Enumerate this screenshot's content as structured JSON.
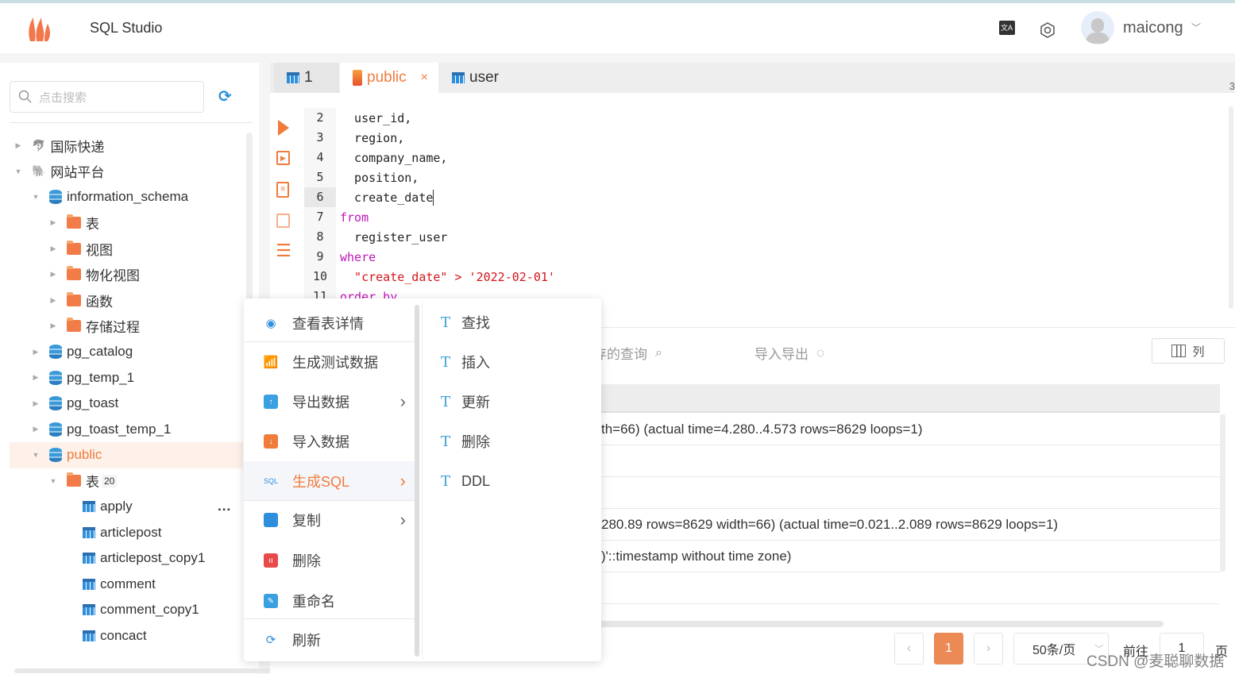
{
  "header": {
    "app_title": "SQL Studio",
    "username": "maicong",
    "icons": [
      "logo-flame",
      "translate-icon",
      "settings-icon",
      "avatar",
      "chevron-down-icon"
    ]
  },
  "sidebar": {
    "search_placeholder": "点击搜索",
    "tree": [
      {
        "label": "国际快递",
        "icon": "mysql-icon",
        "level": 0,
        "expanded": false
      },
      {
        "label": "网站平台",
        "icon": "postgresql-icon",
        "level": 0,
        "expanded": true
      },
      {
        "label": "information_schema",
        "icon": "database-icon",
        "level": 1,
        "expanded": true
      },
      {
        "label": "表",
        "icon": "folder-table-icon",
        "level": 2,
        "expanded": false
      },
      {
        "label": "视图",
        "icon": "folder-view-icon",
        "level": 2,
        "expanded": false
      },
      {
        "label": "物化视图",
        "icon": "folder-mview-icon",
        "level": 2,
        "expanded": false
      },
      {
        "label": "函数",
        "icon": "folder-function-icon",
        "level": 2,
        "expanded": false
      },
      {
        "label": "存储过程",
        "icon": "folder-procedure-icon",
        "level": 2,
        "expanded": false
      },
      {
        "label": "pg_catalog",
        "icon": "database-icon",
        "level": 1,
        "expanded": false
      },
      {
        "label": "pg_temp_1",
        "icon": "database-icon",
        "level": 1,
        "expanded": false
      },
      {
        "label": "pg_toast",
        "icon": "database-icon",
        "level": 1,
        "expanded": false
      },
      {
        "label": "pg_toast_temp_1",
        "icon": "database-icon",
        "level": 1,
        "expanded": false
      },
      {
        "label": "public",
        "icon": "database-icon",
        "level": 1,
        "expanded": true,
        "selected": true
      },
      {
        "label": "表",
        "badge": "20",
        "icon": "folder-table-icon",
        "level": 2,
        "expanded": true
      },
      {
        "label": "apply",
        "icon": "table-icon",
        "level": 3,
        "more": "..."
      },
      {
        "label": "articlepost",
        "icon": "table-icon",
        "level": 3
      },
      {
        "label": "articlepost_copy1",
        "icon": "table-icon",
        "level": 3
      },
      {
        "label": "comment",
        "icon": "table-icon",
        "level": 3
      },
      {
        "label": "comment_copy1",
        "icon": "table-icon",
        "level": 3
      },
      {
        "label": "concact",
        "icon": "table-icon",
        "level": 3
      }
    ]
  },
  "editor": {
    "tabs": [
      {
        "label": "1",
        "icon": "table-icon"
      },
      {
        "label": "public",
        "icon": "scroll-icon",
        "active": true,
        "close": "×"
      },
      {
        "label": "user",
        "icon": "table-icon"
      }
    ],
    "corner_number": "3",
    "lines": [
      {
        "n": "2",
        "parts": [
          {
            "t": "  user_id,",
            "c": "txt"
          }
        ]
      },
      {
        "n": "3",
        "parts": [
          {
            "t": "  region,",
            "c": "txt"
          }
        ]
      },
      {
        "n": "4",
        "parts": [
          {
            "t": "  company_name,",
            "c": "txt"
          }
        ]
      },
      {
        "n": "5",
        "parts": [
          {
            "t": "  position,",
            "c": "txt"
          }
        ]
      },
      {
        "n": "6",
        "parts": [
          {
            "t": "  create_date",
            "c": "txt"
          }
        ],
        "current": true
      },
      {
        "n": "7",
        "parts": [
          {
            "t": "from",
            "c": "kw"
          }
        ]
      },
      {
        "n": "8",
        "parts": [
          {
            "t": "  register_user",
            "c": "txt"
          }
        ]
      },
      {
        "n": "9",
        "parts": [
          {
            "t": "where",
            "c": "kw"
          }
        ]
      },
      {
        "n": "10",
        "parts": [
          {
            "t": "  \"create_date\" > '2022-02-01'",
            "c": "str"
          }
        ]
      },
      {
        "n": "11",
        "parts": [
          {
            "t": "order by",
            "c": "kw"
          }
        ]
      }
    ],
    "colors": {
      "keyword": "#c015b8",
      "string": "#d4141a",
      "accent": "#f07c3c"
    }
  },
  "results": {
    "saved_query_label": "保存的查询",
    "import_export_label": "导入导出",
    "columns_button": "列",
    "rows": [
      "th=66) (actual time=4.280..4.573 rows=8629 loops=1)",
      "",
      "",
      "280.89 rows=8629 width=66) (actual time=0.021..2.089 rows=8629 loops=1)",
      ")'::timestamp without time zone)",
      ""
    ],
    "pagination": {
      "prev": "‹",
      "current": "1",
      "next": "›",
      "page_size": "50条/页",
      "goto_label": "前往",
      "goto_value": "1",
      "page_suffix": "页"
    }
  },
  "context_menu": {
    "items": [
      {
        "label": "查看表详情",
        "icon": "eye-icon"
      },
      {
        "label": "生成测试数据",
        "icon": "chart-icon"
      },
      {
        "label": "导出数据",
        "icon": "export-icon",
        "submenu": true
      },
      {
        "label": "导入数据",
        "icon": "import-icon"
      },
      {
        "label": "生成SQL",
        "icon": "sql-icon",
        "submenu": true,
        "active": true
      },
      {
        "label": "复制",
        "icon": "copy-icon",
        "submenu": true
      },
      {
        "label": "删除",
        "icon": "trash-icon"
      },
      {
        "label": "重命名",
        "icon": "edit-icon"
      },
      {
        "label": "刷新",
        "icon": "refresh-icon"
      }
    ],
    "submenu": [
      {
        "label": "查找"
      },
      {
        "label": "插入"
      },
      {
        "label": "更新"
      },
      {
        "label": "删除"
      },
      {
        "label": "DDL"
      }
    ]
  },
  "watermark": "CSDN @麦聪聊数据"
}
